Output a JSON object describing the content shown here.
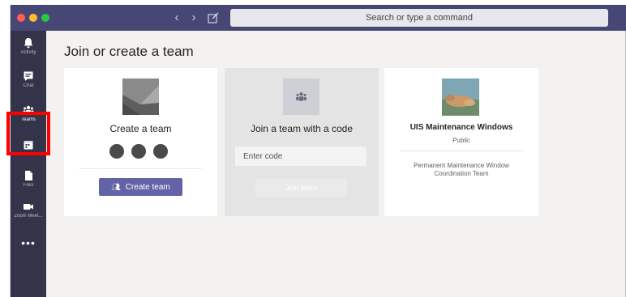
{
  "titlebar": {
    "nav_back": "‹",
    "nav_forward": "›",
    "search_placeholder": "Search or type a command"
  },
  "rail": {
    "items": [
      {
        "label": "Activity",
        "icon": "bell-icon"
      },
      {
        "label": "Chat",
        "icon": "chat-icon"
      },
      {
        "label": "Teams",
        "icon": "teams-icon",
        "active": true
      },
      {
        "label": "Calendar",
        "icon": "calendar-icon"
      },
      {
        "label": "Files",
        "icon": "files-icon"
      },
      {
        "label": "Zoom Meet...",
        "icon": "video-camera-icon"
      }
    ],
    "more": "•••"
  },
  "main": {
    "title": "Join or create a team",
    "create_card": {
      "title": "Create a team",
      "button_label": "Create team"
    },
    "join_card": {
      "title": "Join a team with a code",
      "input_placeholder": "Enter code",
      "button_label": "Join team"
    },
    "team_card": {
      "name": "UIS Maintenance Windows",
      "privacy": "Public",
      "description": "Permanent Maintenance Window Coordination Team"
    }
  },
  "colors": {
    "titlebar": "#464775",
    "rail": "#33344a",
    "accent": "#6264a7",
    "highlight": "#ff0000"
  }
}
